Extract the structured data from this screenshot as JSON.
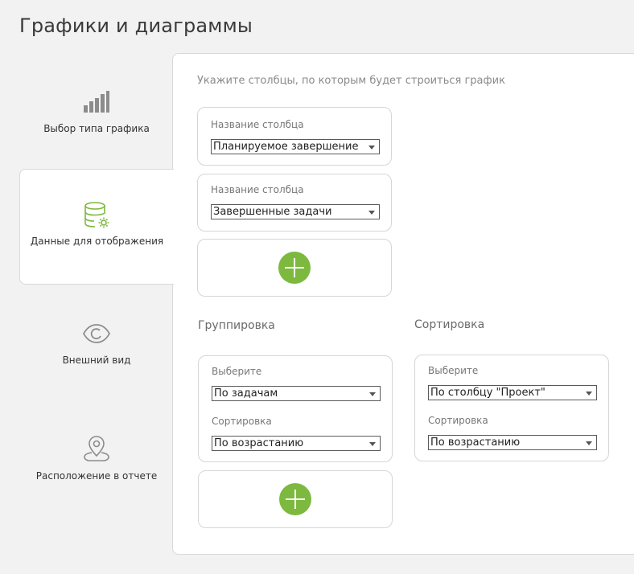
{
  "page": {
    "title": "Графики и диаграммы"
  },
  "nav": {
    "items": [
      {
        "label": "Выбор типа графика",
        "icon": "bar-chart-icon",
        "active": false
      },
      {
        "label": "Данные для отображения",
        "icon": "database-settings-icon",
        "active": true
      },
      {
        "label": "Внешний вид",
        "icon": "eye-icon",
        "active": false
      },
      {
        "label": "Расположение в отчете",
        "icon": "location-pin-icon",
        "active": false
      }
    ]
  },
  "columns": {
    "hint": "Укажите столбцы, по которым будет строиться график",
    "fields": [
      {
        "label": "Название столбца",
        "value": "Планируемое завершение"
      },
      {
        "label": "Название столбца",
        "value": "Завершенные задачи"
      }
    ]
  },
  "grouping": {
    "title": "Группировка",
    "select_label": "Выберите",
    "select_value": "По задачам",
    "sort_label": "Сортировка",
    "sort_value": "По возрастанию"
  },
  "sorting": {
    "title": "Сортировка",
    "select_label": "Выберите",
    "select_value": "По столбцу \"Проект\"",
    "sort_label": "Сортировка",
    "sort_value": "По возрастанию"
  },
  "colors": {
    "accent": "#7cb93e",
    "icon_gray": "#8c8c8c"
  }
}
